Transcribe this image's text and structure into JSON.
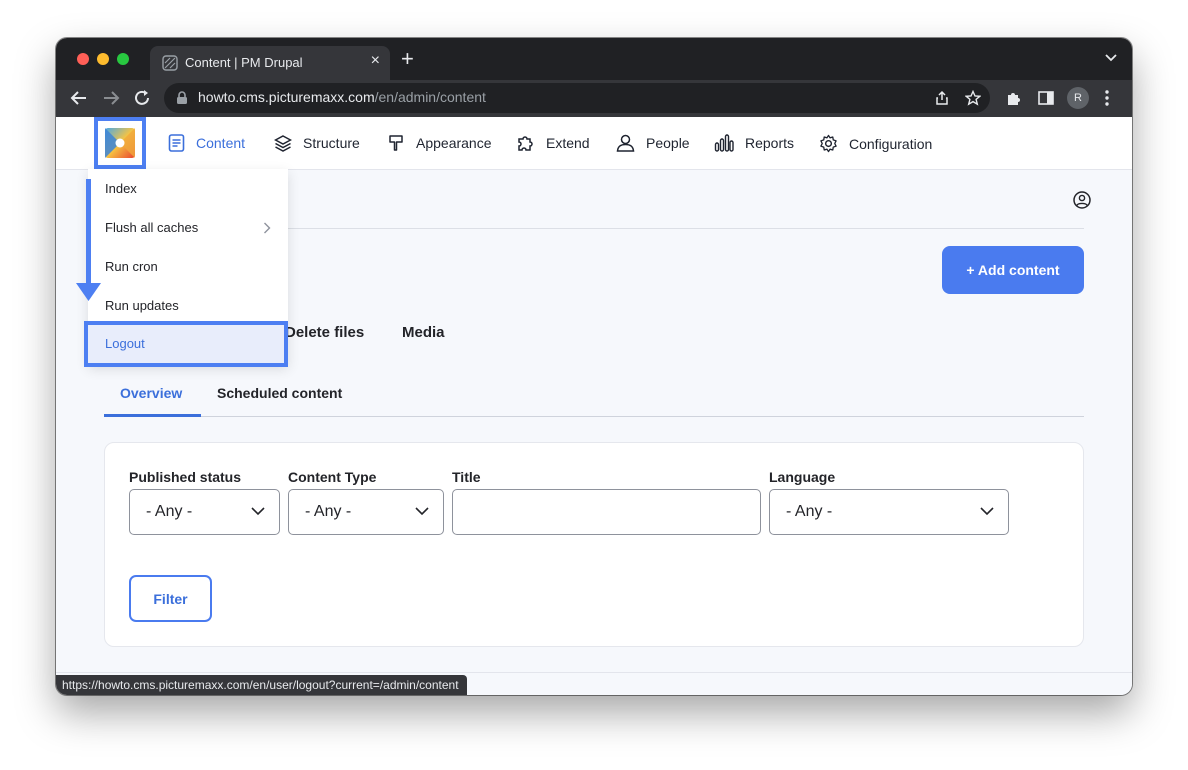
{
  "browser": {
    "tab_title": "Content | PM Drupal",
    "tab_close": "×",
    "new_tab": "+",
    "url_host": "howto.cms.picturemaxx.com",
    "url_path": "/en/admin/content",
    "profile_initial": "R",
    "status_url": "https://howto.cms.picturemaxx.com/en/user/logout?current=/admin/content"
  },
  "admin_nav": {
    "items": [
      {
        "label": "Content",
        "icon": "document-icon",
        "active": true
      },
      {
        "label": "Structure",
        "icon": "layers-icon"
      },
      {
        "label": "Appearance",
        "icon": "paint-brush-icon"
      },
      {
        "label": "Extend",
        "icon": "puzzle-icon"
      },
      {
        "label": "People",
        "icon": "person-icon"
      },
      {
        "label": "Reports",
        "icon": "bar-chart-icon"
      },
      {
        "label": "Configuration",
        "icon": "gear-icon"
      }
    ]
  },
  "dropdown": {
    "items": [
      "Index",
      "Flush all caches",
      "Run cron",
      "Run updates"
    ],
    "logout": "Logout"
  },
  "page": {
    "add_content": "+ Add content",
    "sub_tabs": [
      "Delete files",
      "Media"
    ],
    "tabs": [
      "Overview",
      "Scheduled content"
    ]
  },
  "filters": {
    "published_status": {
      "label": "Published status",
      "value": "- Any -"
    },
    "content_type": {
      "label": "Content Type",
      "value": "- Any -"
    },
    "title": {
      "label": "Title",
      "value": ""
    },
    "language": {
      "label": "Language",
      "value": "- Any -"
    },
    "filter_button": "Filter"
  },
  "colors": {
    "accent": "#4a7bef",
    "highlight": "#4d7ff2",
    "browser_chrome": "#35363a"
  }
}
